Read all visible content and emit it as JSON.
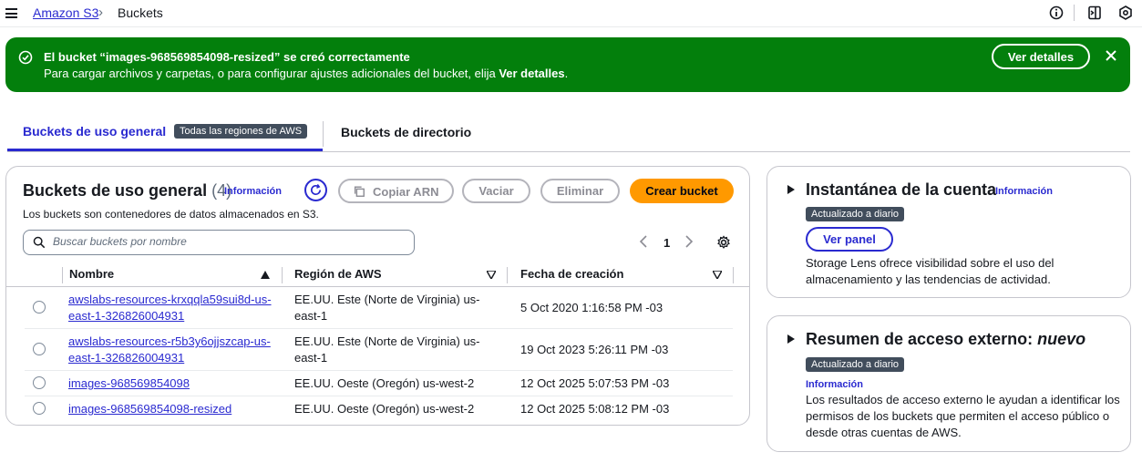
{
  "breadcrumb": {
    "root": "Amazon S3",
    "separator": "›",
    "current": "Buckets"
  },
  "flash": {
    "title": "El bucket “images-968569854098-resized” se creó correctamente",
    "message_prefix": "Para cargar archivos y carpetas, o para configurar ajustes adicionales del bucket, elija ",
    "message_link": "Ver detalles",
    "message_suffix": ".",
    "button": "Ver detalles",
    "color": "#037f0c"
  },
  "tabs": [
    {
      "label": "Buckets de uso general",
      "badge": "Todas las regiones de AWS",
      "active": true
    },
    {
      "label": "Buckets de directorio",
      "active": false
    }
  ],
  "panel": {
    "title": "Buckets de uso general",
    "count": "(4)",
    "info": "Información",
    "description": "Los buckets son contenedores de datos almacenados en S3.",
    "buttons": {
      "copy_arn": "Copiar ARN",
      "empty": "Vaciar",
      "delete": "Eliminar",
      "create": "Crear bucket"
    },
    "search_placeholder": "Buscar buckets por nombre",
    "page": "1"
  },
  "table": {
    "columns": [
      "Nombre",
      "Región de AWS",
      "Fecha de creación"
    ],
    "rows": [
      {
        "name": "awslabs-resources-krxqqla59sui8d-us-east-1-326826004931",
        "region": "EE.UU. Este (Norte de Virginia) us-east-1",
        "date": "5 Oct 2020 1:16:58 PM -03"
      },
      {
        "name": "awslabs-resources-r5b3y6ojjszcap-us-east-1-326826004931",
        "region": "EE.UU. Este (Norte de Virginia) us-east-1",
        "date": "19 Oct 2023 5:26:11 PM -03"
      },
      {
        "name": "images-968569854098",
        "region": "EE.UU. Oeste (Oregón) us-west-2",
        "date": "12 Oct 2025 5:07:53 PM -03"
      },
      {
        "name": "images-968569854098-resized",
        "region": "EE.UU. Oeste (Oregón) us-west-2",
        "date": "12 Oct 2025 5:08:12 PM -03"
      }
    ]
  },
  "cards": {
    "snapshot": {
      "title": "Instantánea de la cuenta",
      "info": "Información",
      "badge": "Actualizado a diario",
      "button": "Ver panel",
      "text": "Storage Lens ofrece visibilidad sobre el uso del almacenamiento y las tendencias de actividad."
    },
    "external": {
      "title": "Resumen de acceso externo: ",
      "title_new": "nuevo",
      "badge": "Actualizado a diario",
      "info": "Información",
      "text": "Los resultados de acceso externo le ayudan a identificar los permisos de los buckets que permiten el acceso público o desde otras cuentas de AWS."
    }
  },
  "colors": {
    "link": "#2a2ad0",
    "primary": "#ff9900",
    "success": "#037f0c"
  }
}
